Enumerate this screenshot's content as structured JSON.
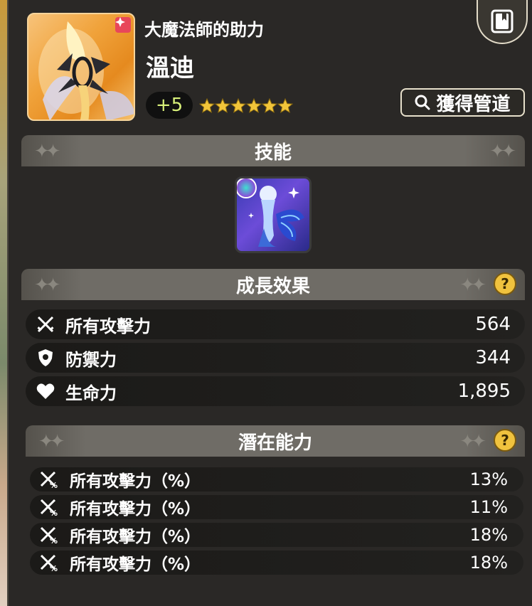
{
  "header": {
    "subtitle": "大魔法師的助力",
    "name": "溫迪",
    "enhance_level": "+5",
    "star_count": 6,
    "acquire_label": "獲得管道"
  },
  "sections": {
    "skill_title": "技能",
    "growth_title": "成長效果",
    "potential_title": "潛在能力"
  },
  "growth_stats": [
    {
      "label": "所有攻擊力",
      "value": "564",
      "icon": "swords-icon"
    },
    {
      "label": "防禦力",
      "value": "344",
      "icon": "shield-icon"
    },
    {
      "label": "生命力",
      "value": "1,895",
      "icon": "heart-icon"
    }
  ],
  "potentials": [
    {
      "label": "所有攻擊力（%）",
      "value": "13%"
    },
    {
      "label": "所有攻擊力（%）",
      "value": "11%"
    },
    {
      "label": "所有攻擊力（%）",
      "value": "18%"
    },
    {
      "label": "所有攻擊力（%）",
      "value": "18%"
    }
  ],
  "colors": {
    "panel_bg": "#2a2826",
    "section_header": "#6f6c66",
    "enhance_text": "#d8f07a",
    "star": "#f2c53a",
    "help_icon": "#f0c23e"
  }
}
